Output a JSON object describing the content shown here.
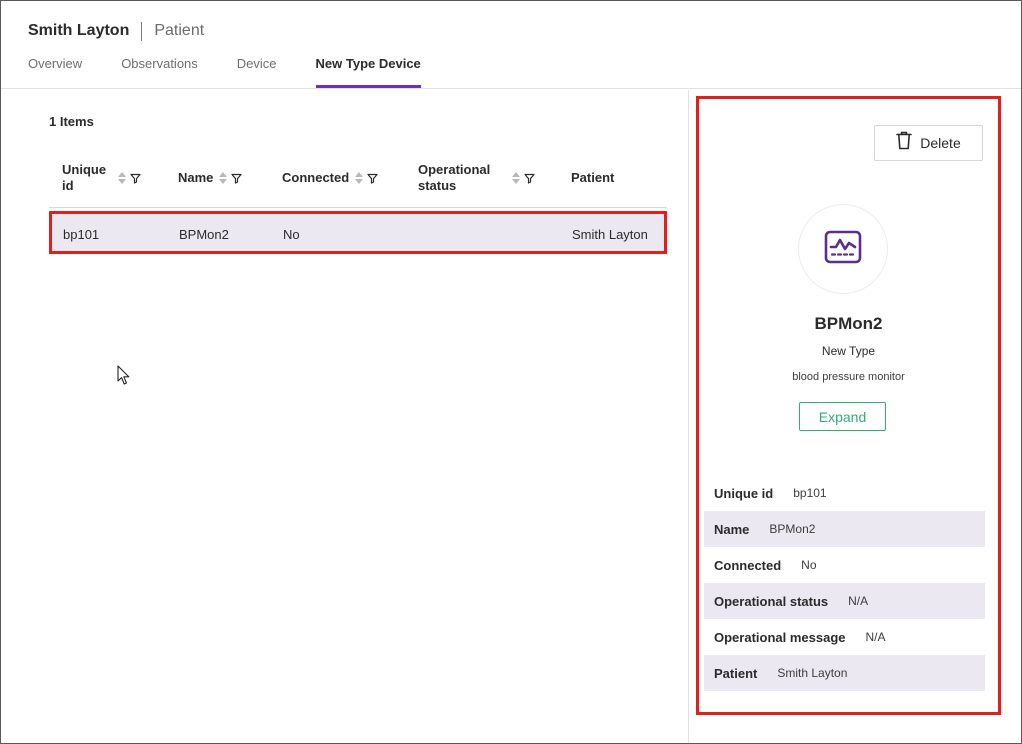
{
  "header": {
    "patient_name": "Smith Layton",
    "subtitle": "Patient",
    "tabs": [
      {
        "label": "Overview",
        "active": false
      },
      {
        "label": "Observations",
        "active": false
      },
      {
        "label": "Device",
        "active": false
      },
      {
        "label": "New Type Device",
        "active": true
      }
    ]
  },
  "list": {
    "count_label": "1 Items",
    "columns": [
      "Unique id",
      "Name",
      "Connected",
      "Operational status",
      "Patient"
    ],
    "rows": [
      {
        "unique_id": "bp101",
        "name": "BPMon2",
        "connected": "No",
        "operational_status": "",
        "patient": "Smith Layton",
        "selected": true
      }
    ]
  },
  "detail": {
    "delete_label": "Delete",
    "icon": "monitor-waveform-icon",
    "name": "BPMon2",
    "type": "New Type",
    "description": "blood pressure monitor",
    "expand_label": "Expand",
    "properties": [
      {
        "label": "Unique id",
        "value": "bp101"
      },
      {
        "label": "Name",
        "value": "BPMon2"
      },
      {
        "label": "Connected",
        "value": "No"
      },
      {
        "label": "Operational status",
        "value": "N/A"
      },
      {
        "label": "Operational message",
        "value": "N/A"
      },
      {
        "label": "Patient",
        "value": "Smith Layton"
      }
    ]
  },
  "colors": {
    "accent": "#6b2fc9",
    "highlight_border": "#e01f1f",
    "expand_green": "#2fae78",
    "row_selected": "#ebe8f1"
  }
}
